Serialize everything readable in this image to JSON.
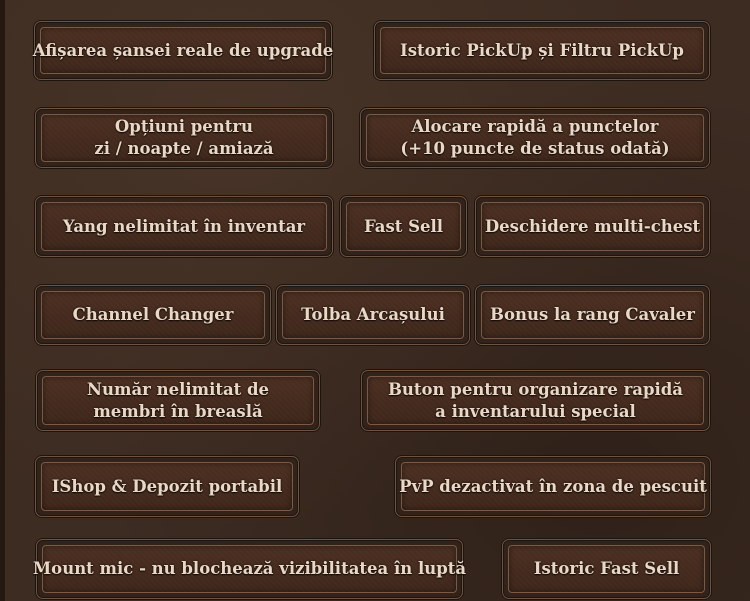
{
  "features": {
    "real_upgrade_chance": "Afișarea șansei reale de upgrade",
    "pickup_history": "Istoric PickUp și Filtru PickUp",
    "day_night_options": [
      "Opțiuni pentru",
      "zi / noapte / amiază"
    ],
    "quick_points": [
      "Alocare rapidă a punctelor",
      "(+10 puncte de status odată)"
    ],
    "unlimited_yang": "Yang nelimitat în inventar",
    "fast_sell": "Fast Sell",
    "multi_chest": "Deschidere multi-chest",
    "channel_changer": "Channel Changer",
    "archer_quiver": "Tolba Arcașului",
    "knight_rank_bonus": "Bonus la rang Cavaler",
    "guild_members": [
      "Număr nelimitat de",
      "membri în breaslă"
    ],
    "special_inventory_sort": [
      "Buton pentru organizare rapidă",
      "a inventarului special"
    ],
    "portable_shop": "IShop & Depozit portabil",
    "pvp_fishing": "PvP dezactivat în zona de pescuit",
    "small_mount": "Mount mic - nu blochează vizibilitatea în luptă",
    "fast_sell_history": "Istoric Fast Sell"
  }
}
